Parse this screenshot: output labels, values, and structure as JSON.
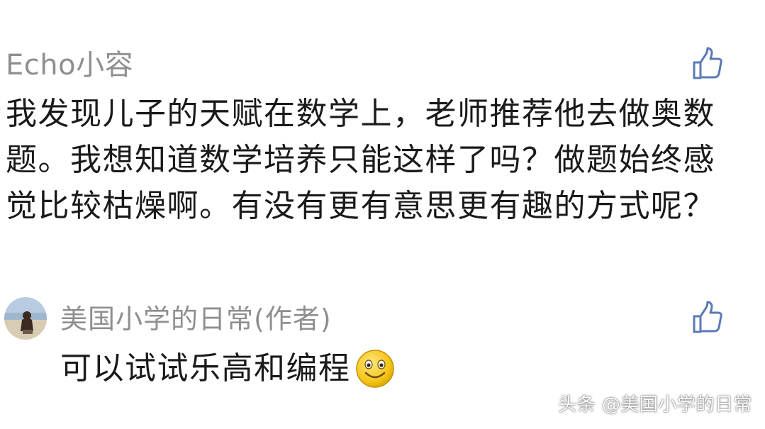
{
  "main_comment": {
    "username": "Echo小容",
    "text": "我发现儿子的天赋在数学上，老师推荐他去做奥数题。我想知道数学培养只能这样了吗？做题始终感觉比较枯燥啊。有没有更有意思更有趣的方式呢？",
    "like_icon": "thumbs-up-icon"
  },
  "reply": {
    "username": "美国小学的日常(作者)",
    "text": "可以试试乐高和编程",
    "emoji_icon": "smiley-face-icon",
    "like_icon": "thumbs-up-icon"
  },
  "watermark": {
    "text": "头条 @美国小学的日常"
  },
  "colors": {
    "username_gray": "#8f8f8f",
    "text_dark": "#1a1a1a",
    "like_blue": "#5b7ab6",
    "emoji_yellow": "#f5c518"
  }
}
